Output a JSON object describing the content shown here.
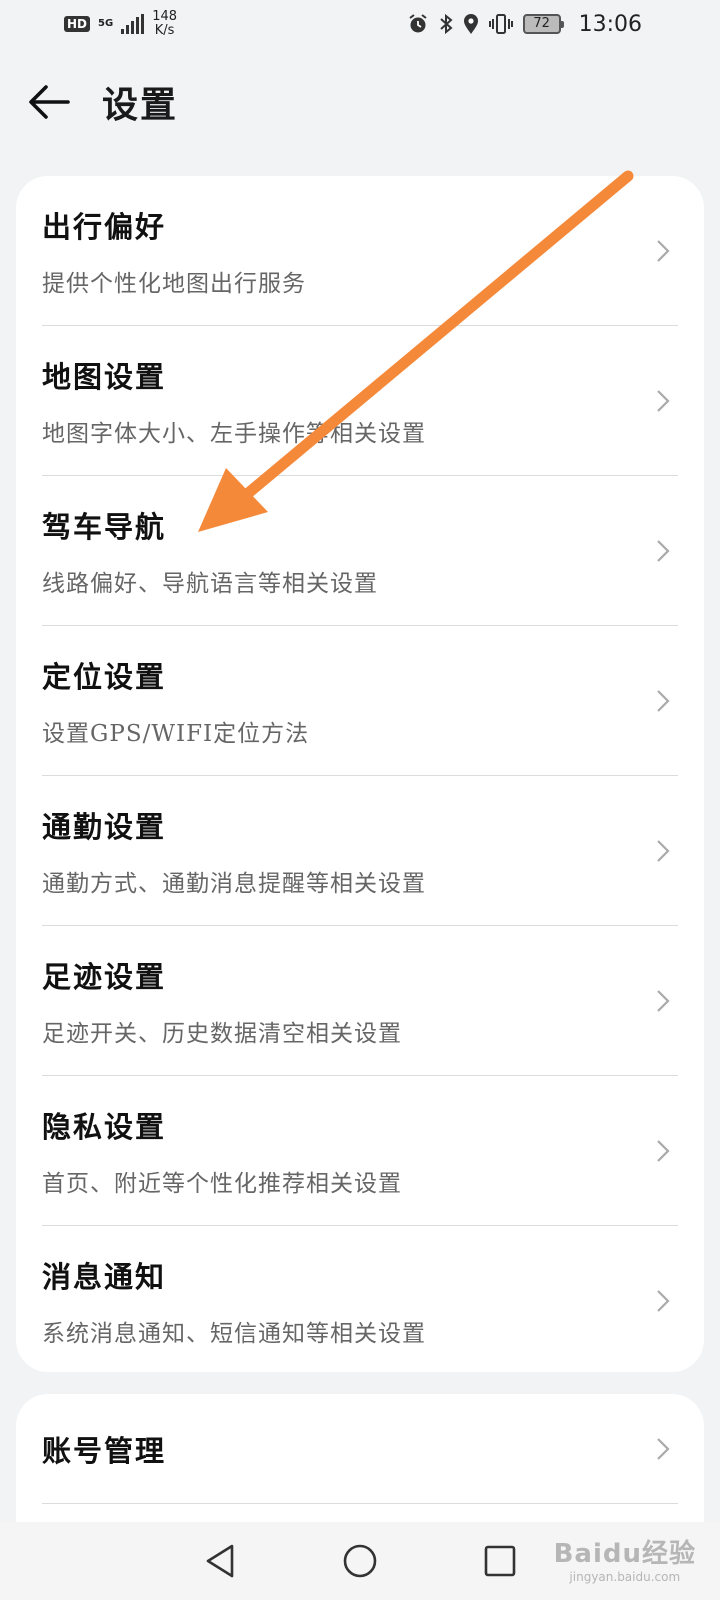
{
  "status_bar": {
    "hd": "HD",
    "network": "5G",
    "speed_value": "148",
    "speed_unit": "K/s",
    "battery": "72",
    "time": "13:06",
    "icons": [
      "alarm-icon",
      "bluetooth-icon",
      "location-icon",
      "vibrate-icon"
    ]
  },
  "header": {
    "title": "设置"
  },
  "settings_items": [
    {
      "title": "出行偏好",
      "subtitle": "提供个性化地图出行服务"
    },
    {
      "title": "地图设置",
      "subtitle": "地图字体大小、左手操作等相关设置"
    },
    {
      "title": "驾车导航",
      "subtitle": "线路偏好、导航语言等相关设置"
    },
    {
      "title": "定位设置",
      "subtitle": "设置GPS/WIFI定位方法"
    },
    {
      "title": "通勤设置",
      "subtitle": "通勤方式、通勤消息提醒等相关设置"
    },
    {
      "title": "足迹设置",
      "subtitle": "足迹开关、历史数据清空相关设置"
    },
    {
      "title": "隐私设置",
      "subtitle": "首页、附近等个性化推荐相关设置"
    },
    {
      "title": "消息通知",
      "subtitle": "系统消息通知、短信通知等相关设置"
    }
  ],
  "account_items": [
    {
      "title": "账号管理"
    }
  ],
  "annotation": {
    "color": "#f5893a"
  },
  "watermark": {
    "text": "Baidu经验",
    "url": "jingyan.baidu.com"
  },
  "colors": {
    "background": "#f1f3f5",
    "card": "#ffffff",
    "subtitle": "#666666"
  }
}
